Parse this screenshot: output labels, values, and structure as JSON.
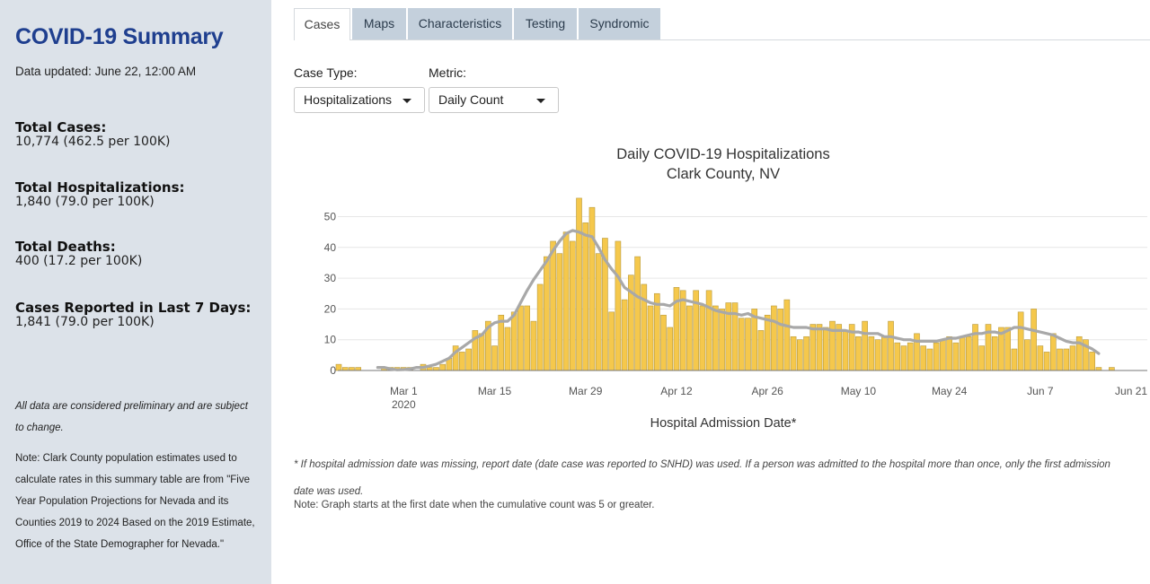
{
  "sidebar": {
    "title": "COVID-19 Summary",
    "updated": "Data updated: June 22, 12:00 AM",
    "stats": [
      {
        "label": "Total Cases:",
        "value": "10,774 (462.5 per 100K)"
      },
      {
        "label": "Total Hospitalizations:",
        "value": "1,840 (79.0 per 100K)"
      },
      {
        "label": "Total Deaths:",
        "value": "400 (17.2 per 100K)"
      },
      {
        "label": "Cases Reported in Last 7 Days:",
        "value": "1,841 (79.0 per 100K)"
      }
    ],
    "preliminary_note": "All data are considered preliminary and are subject to change.",
    "population_note": "Note: Clark County population estimates used to calculate rates in this summary table are from \"Five Year Population Projections for Nevada and its Counties 2019 to 2024 Based on the 2019 Estimate, Office of the State Demographer for Nevada.\""
  },
  "tabs": [
    "Cases",
    "Maps",
    "Characteristics",
    "Testing",
    "Syndromic"
  ],
  "active_tab": "Cases",
  "controls": {
    "case_type_label": "Case Type:",
    "case_type_value": "Hospitalizations",
    "metric_label": "Metric:",
    "metric_value": "Daily Count"
  },
  "chart_data": {
    "type": "bar",
    "title": "Daily COVID-19 Hospitalizations",
    "subtitle": "Clark County, NV",
    "xlabel": "Hospital Admission Date*",
    "ylabel": "",
    "ylim": [
      0,
      57
    ],
    "yticks": [
      0,
      10,
      20,
      30,
      40,
      50
    ],
    "xticks": [
      {
        "day": 10,
        "label": "Mar 1",
        "sublabel": "2020"
      },
      {
        "day": 24,
        "label": "Mar 15"
      },
      {
        "day": 38,
        "label": "Mar 29"
      },
      {
        "day": 52,
        "label": "Apr 12"
      },
      {
        "day": 66,
        "label": "Apr 26"
      },
      {
        "day": 80,
        "label": "May 10"
      },
      {
        "day": 94,
        "label": "May 24"
      },
      {
        "day": 108,
        "label": "Jun 7"
      },
      {
        "day": 122,
        "label": "Jun 21"
      }
    ],
    "bar_color": "#f5c84c",
    "line_color": "#a8a8a8",
    "series": [
      {
        "values": [
          2,
          1,
          1,
          1,
          0,
          0,
          0,
          1,
          1,
          1,
          1,
          1,
          0,
          2,
          1,
          1,
          2,
          4,
          8,
          6,
          7,
          13,
          12,
          16,
          8,
          18,
          14,
          19,
          21,
          21,
          16,
          28,
          37,
          42,
          38,
          45,
          42,
          56,
          48,
          53,
          38,
          43,
          19,
          42,
          23,
          31,
          37,
          28,
          21,
          25,
          18,
          14,
          27,
          26,
          21,
          26,
          21,
          26,
          21,
          20,
          22,
          22,
          17,
          17,
          20,
          13,
          18,
          21,
          20,
          23,
          11,
          10,
          11,
          15,
          15,
          14,
          16,
          15,
          13,
          15,
          11,
          16,
          11,
          10,
          11,
          16,
          9,
          8,
          9,
          12,
          8,
          7,
          9,
          10,
          11,
          9,
          11,
          11,
          15,
          8,
          15,
          11,
          14,
          14,
          7,
          19,
          10,
          20,
          8,
          6,
          12,
          7,
          7,
          8,
          11,
          10,
          6,
          1,
          0,
          1
        ]
      },
      {
        "values": [
          null,
          null,
          null,
          null,
          null,
          null,
          1,
          1,
          0.5,
          0.2,
          0.3,
          0.5,
          1,
          1,
          1.5,
          2,
          3,
          4,
          6,
          7.5,
          9,
          10.5,
          11.5,
          14,
          15.5,
          16,
          16,
          18,
          22,
          26,
          29.5,
          32.5,
          35.5,
          39,
          42,
          44.5,
          45.5,
          45,
          44,
          43.5,
          40,
          36,
          33,
          30.5,
          27,
          25.5,
          24,
          23,
          22,
          21.5,
          21.5,
          21,
          22.5,
          23,
          22.5,
          22,
          21.5,
          20.5,
          19.5,
          19,
          18.5,
          18.5,
          18,
          18.5,
          17.5,
          17,
          16.5,
          16,
          15,
          14.5,
          14,
          14,
          14,
          13.5,
          13.5,
          13.5,
          13,
          13,
          13,
          12.5,
          12.5,
          12,
          12,
          12,
          11,
          11,
          10.5,
          10,
          10,
          9.5,
          9.5,
          9.5,
          9.5,
          10,
          10.5,
          10.5,
          11,
          11.5,
          12,
          12,
          12.5,
          12.5,
          12,
          13,
          14,
          14,
          13.5,
          13,
          12.5,
          12,
          11.5,
          10.5,
          9.5,
          9,
          9,
          8,
          7,
          5.5
        ]
      }
    ],
    "start_day": 0
  },
  "footnote": "* If hospital admission date was missing, report date (date case was reported to SNHD) was used. If a person was admitted to the hospital more than once, only the first admission date was used.",
  "graph_note": "Note: Graph starts at the first date when the cumulative count was 5 or greater."
}
